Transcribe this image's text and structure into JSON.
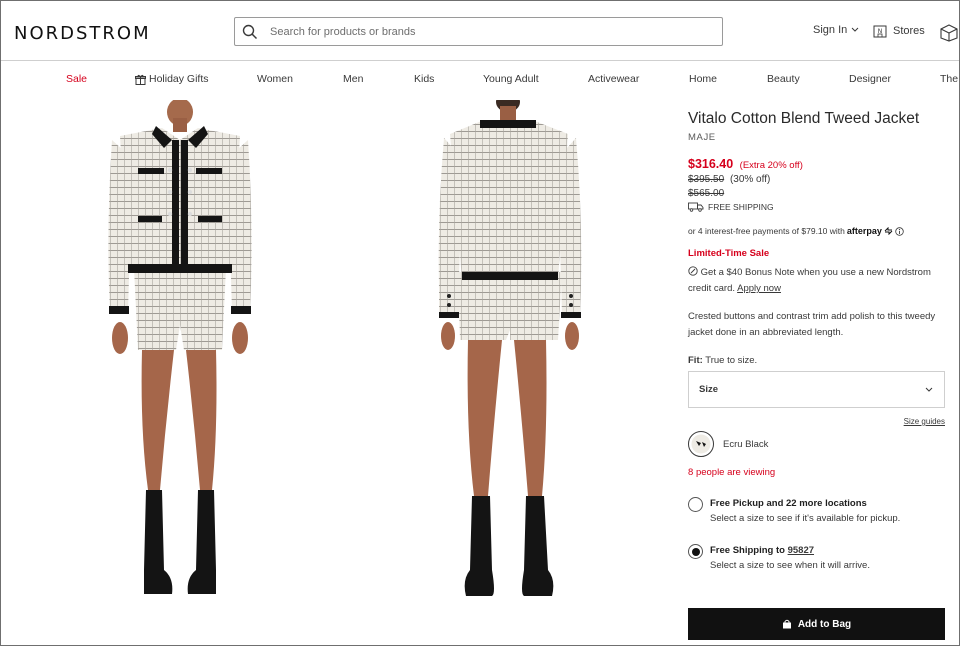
{
  "header": {
    "logo": "NORDSTROM",
    "search_placeholder": "Search for products or brands",
    "sign_in": "Sign In",
    "stores": "Stores"
  },
  "nav": {
    "items": [
      "Sale",
      "Holiday Gifts",
      "Women",
      "Men",
      "Kids",
      "Young Adult",
      "Activewear",
      "Home",
      "Beauty",
      "Designer",
      "The"
    ]
  },
  "product": {
    "title": "Vitalo Cotton Blend Tweed Jacket",
    "brand": "MAJE",
    "price_sale": "$316.40",
    "price_extra": "(Extra 20% off)",
    "price_was": "$395.50",
    "price_was_off": "(30% off)",
    "price_original": "$565.00",
    "free_shipping": "FREE SHIPPING",
    "afterpay_text": "or 4 interest-free payments of $79.10 with",
    "afterpay_brand": "afterpay",
    "limited_sale": "Limited-Time Sale",
    "bonus_text": "Get a $40 Bonus Note when you use a new Nordstrom credit card.",
    "apply_now": "Apply now",
    "description": "Crested buttons and contrast trim add polish to this tweedy jacket done in an abbreviated length.",
    "fit_label": "Fit:",
    "fit_value": "True to size.",
    "size_label": "Size",
    "size_guides": "Size guides",
    "color_name": "Ecru Black",
    "viewing_count": "8",
    "viewing_text": "people are viewing",
    "pickup_head": "Free Pickup and 22 more locations",
    "pickup_sub": "Select a size to see if it's available for pickup.",
    "shipping_head": "Free Shipping to",
    "shipping_zip": "95827",
    "shipping_sub": "Select a size to see when it will arrive.",
    "add_to_bag": "Add to Bag"
  },
  "colors": {
    "sale_red": "#d6001c",
    "button_black": "#111111"
  }
}
